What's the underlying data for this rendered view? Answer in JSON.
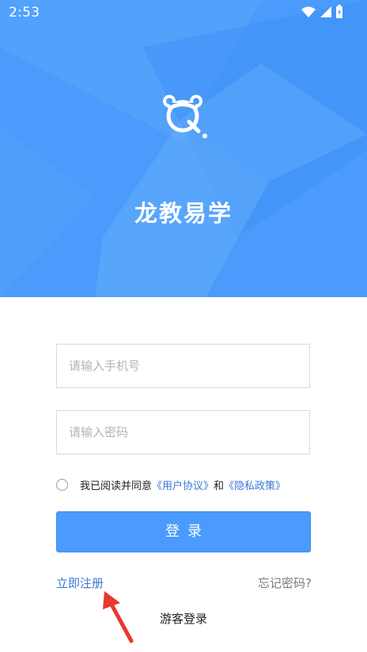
{
  "status_bar": {
    "time": "2:53"
  },
  "header": {
    "app_name": "龙教易学"
  },
  "form": {
    "phone_placeholder": "请输入手机号",
    "password_placeholder": "请输入密码",
    "agreement": {
      "prefix": "我已阅读并同意",
      "user_agreement": "《用户协议》",
      "and": "和",
      "privacy_policy": "《隐私政策》"
    },
    "login_label": "登录"
  },
  "links": {
    "register": "立即注册",
    "forgot_password": "忘记密码?",
    "guest_login": "游客登录"
  },
  "colors": {
    "brand_blue": "#4a9bfb",
    "link_blue": "#3a77d8",
    "annotation_red": "#e8382f"
  }
}
